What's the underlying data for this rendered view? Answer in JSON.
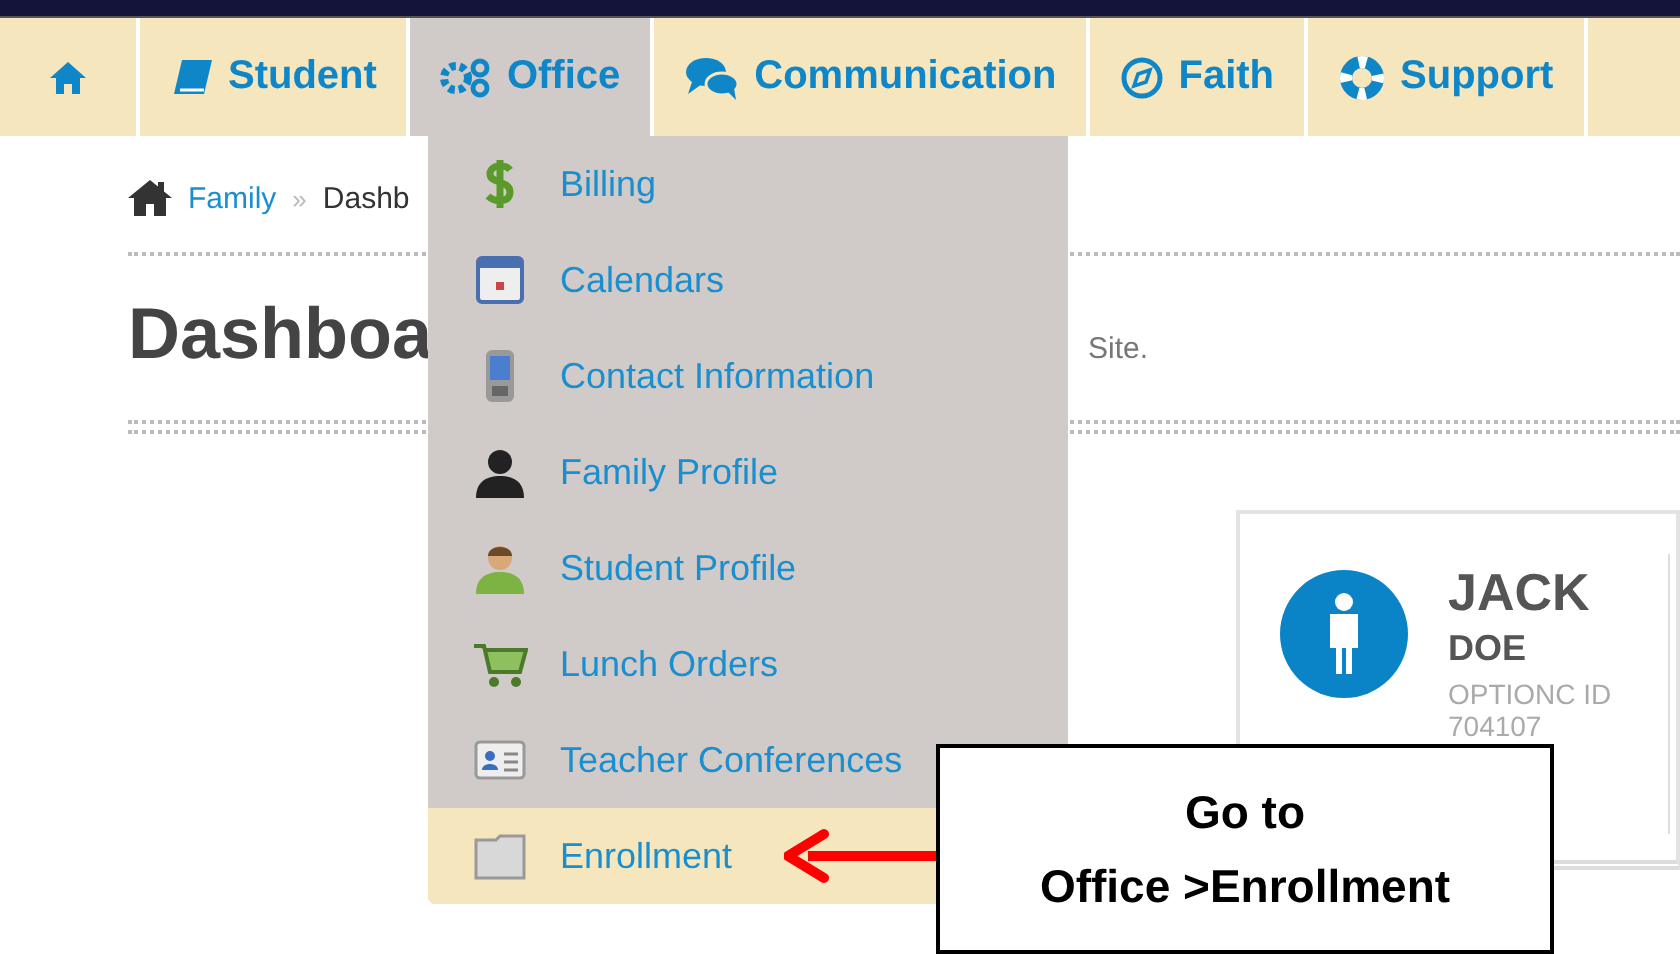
{
  "nav": {
    "tabs": [
      {
        "kind": "home",
        "selected": false
      },
      {
        "kind": "book",
        "label": "Student",
        "selected": false
      },
      {
        "kind": "gears",
        "label": "Office",
        "selected": true
      },
      {
        "kind": "chat",
        "label": "Communication",
        "selected": false
      },
      {
        "kind": "compass",
        "label": "Faith",
        "selected": false
      },
      {
        "kind": "lifebuoy",
        "label": "Support",
        "selected": false
      }
    ]
  },
  "breadcrumb": {
    "items": [
      "Family",
      "Dashb"
    ],
    "separator": "»"
  },
  "page": {
    "title": "Dashboa",
    "subtitle": "Site."
  },
  "menu": {
    "items": [
      {
        "kind": "dollar",
        "label": "Billing",
        "selected": false
      },
      {
        "kind": "calendar",
        "label": "Calendars",
        "selected": false
      },
      {
        "kind": "phone",
        "label": "Contact Information",
        "selected": false
      },
      {
        "kind": "person",
        "label": "Family Profile",
        "selected": false
      },
      {
        "kind": "student",
        "label": "Student Profile",
        "selected": false
      },
      {
        "kind": "cart",
        "label": "Lunch Orders",
        "selected": false
      },
      {
        "kind": "card",
        "label": "Teacher Conferences",
        "selected": false
      },
      {
        "kind": "folder",
        "label": "Enrollment",
        "selected": true
      }
    ]
  },
  "student_card": {
    "first_name": "JACK",
    "last_name": "DOE",
    "id_label": "OPTIONC ID",
    "id": "704107"
  },
  "callout": {
    "lines": [
      "Go to",
      "Office >Enrollment"
    ]
  }
}
